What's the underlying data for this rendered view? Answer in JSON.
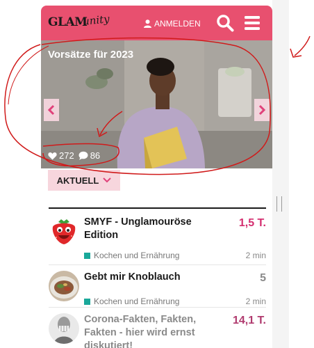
{
  "header": {
    "logo_main": "GLAM",
    "logo_script": "unity",
    "login_label": "ANMELDEN",
    "search_icon": "search-icon",
    "menu_icon": "hamburger-menu-icon",
    "user_icon": "user-icon",
    "color": "#e8506f"
  },
  "hero": {
    "title": "Vorsätze für 2023",
    "likes": "272",
    "comments": "86",
    "like_icon": "heart-icon",
    "comment_icon": "speech-bubble-icon",
    "prev_icon": "chevron-left-icon",
    "next_icon": "chevron-right-icon"
  },
  "tab": {
    "label": "AKTUELL",
    "icon": "chevron-down-icon"
  },
  "topics": [
    {
      "title": "SMYF - Unglamouröse Edition",
      "count": "1,5 T.",
      "count_color": "#d42e6f",
      "category": "Kochen und Ernährung",
      "age": "2 min",
      "avatar": "strawberry-avatar"
    },
    {
      "title": "Gebt mir Knoblauch",
      "count": "5",
      "count_color": "#8a8a8a",
      "category": "Kochen und Ernährung",
      "age": "2 min",
      "avatar": "plate-avatar"
    },
    {
      "title": "Corona-Fakten, Fakten, Fakten - hier wird ernst diskutiert!",
      "count": "14,1 T.",
      "count_color": "#b03a6e",
      "avatar": "person-avatar"
    }
  ]
}
